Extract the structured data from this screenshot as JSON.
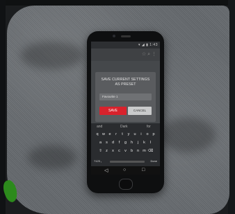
{
  "status_bar": {
    "icons": "▾ ◢ ▮ 1:43"
  },
  "app_bar": {
    "title": "",
    "actions": "☆ ⌕ ⋮"
  },
  "dialog": {
    "title_line1": "SAVE CURRENT SETTINGS",
    "title_line2": "AS PRESET",
    "input_value": "Favourite 1",
    "save_label": "SAVE",
    "cancel_label": "CANCEL"
  },
  "keyboard": {
    "suggestions": [
      "and",
      "Dark",
      "for"
    ],
    "row1": [
      "q",
      "w",
      "e",
      "r",
      "t",
      "y",
      "u",
      "i",
      "o",
      "p"
    ],
    "row2": [
      "a",
      "s",
      "d",
      "f",
      "g",
      "h",
      "j",
      "k",
      "l"
    ],
    "row3": [
      "⇧",
      "z",
      "x",
      "c",
      "v",
      "b",
      "n",
      "m",
      "⌫"
    ],
    "num_key": "?123",
    "mic_key": ",",
    "enter_key": "Done"
  },
  "nav": {
    "back": "◁",
    "home": "○",
    "recents": "□"
  },
  "colors": {
    "accent": "#d8222c",
    "dialog_bg": "#5a5c5f"
  }
}
